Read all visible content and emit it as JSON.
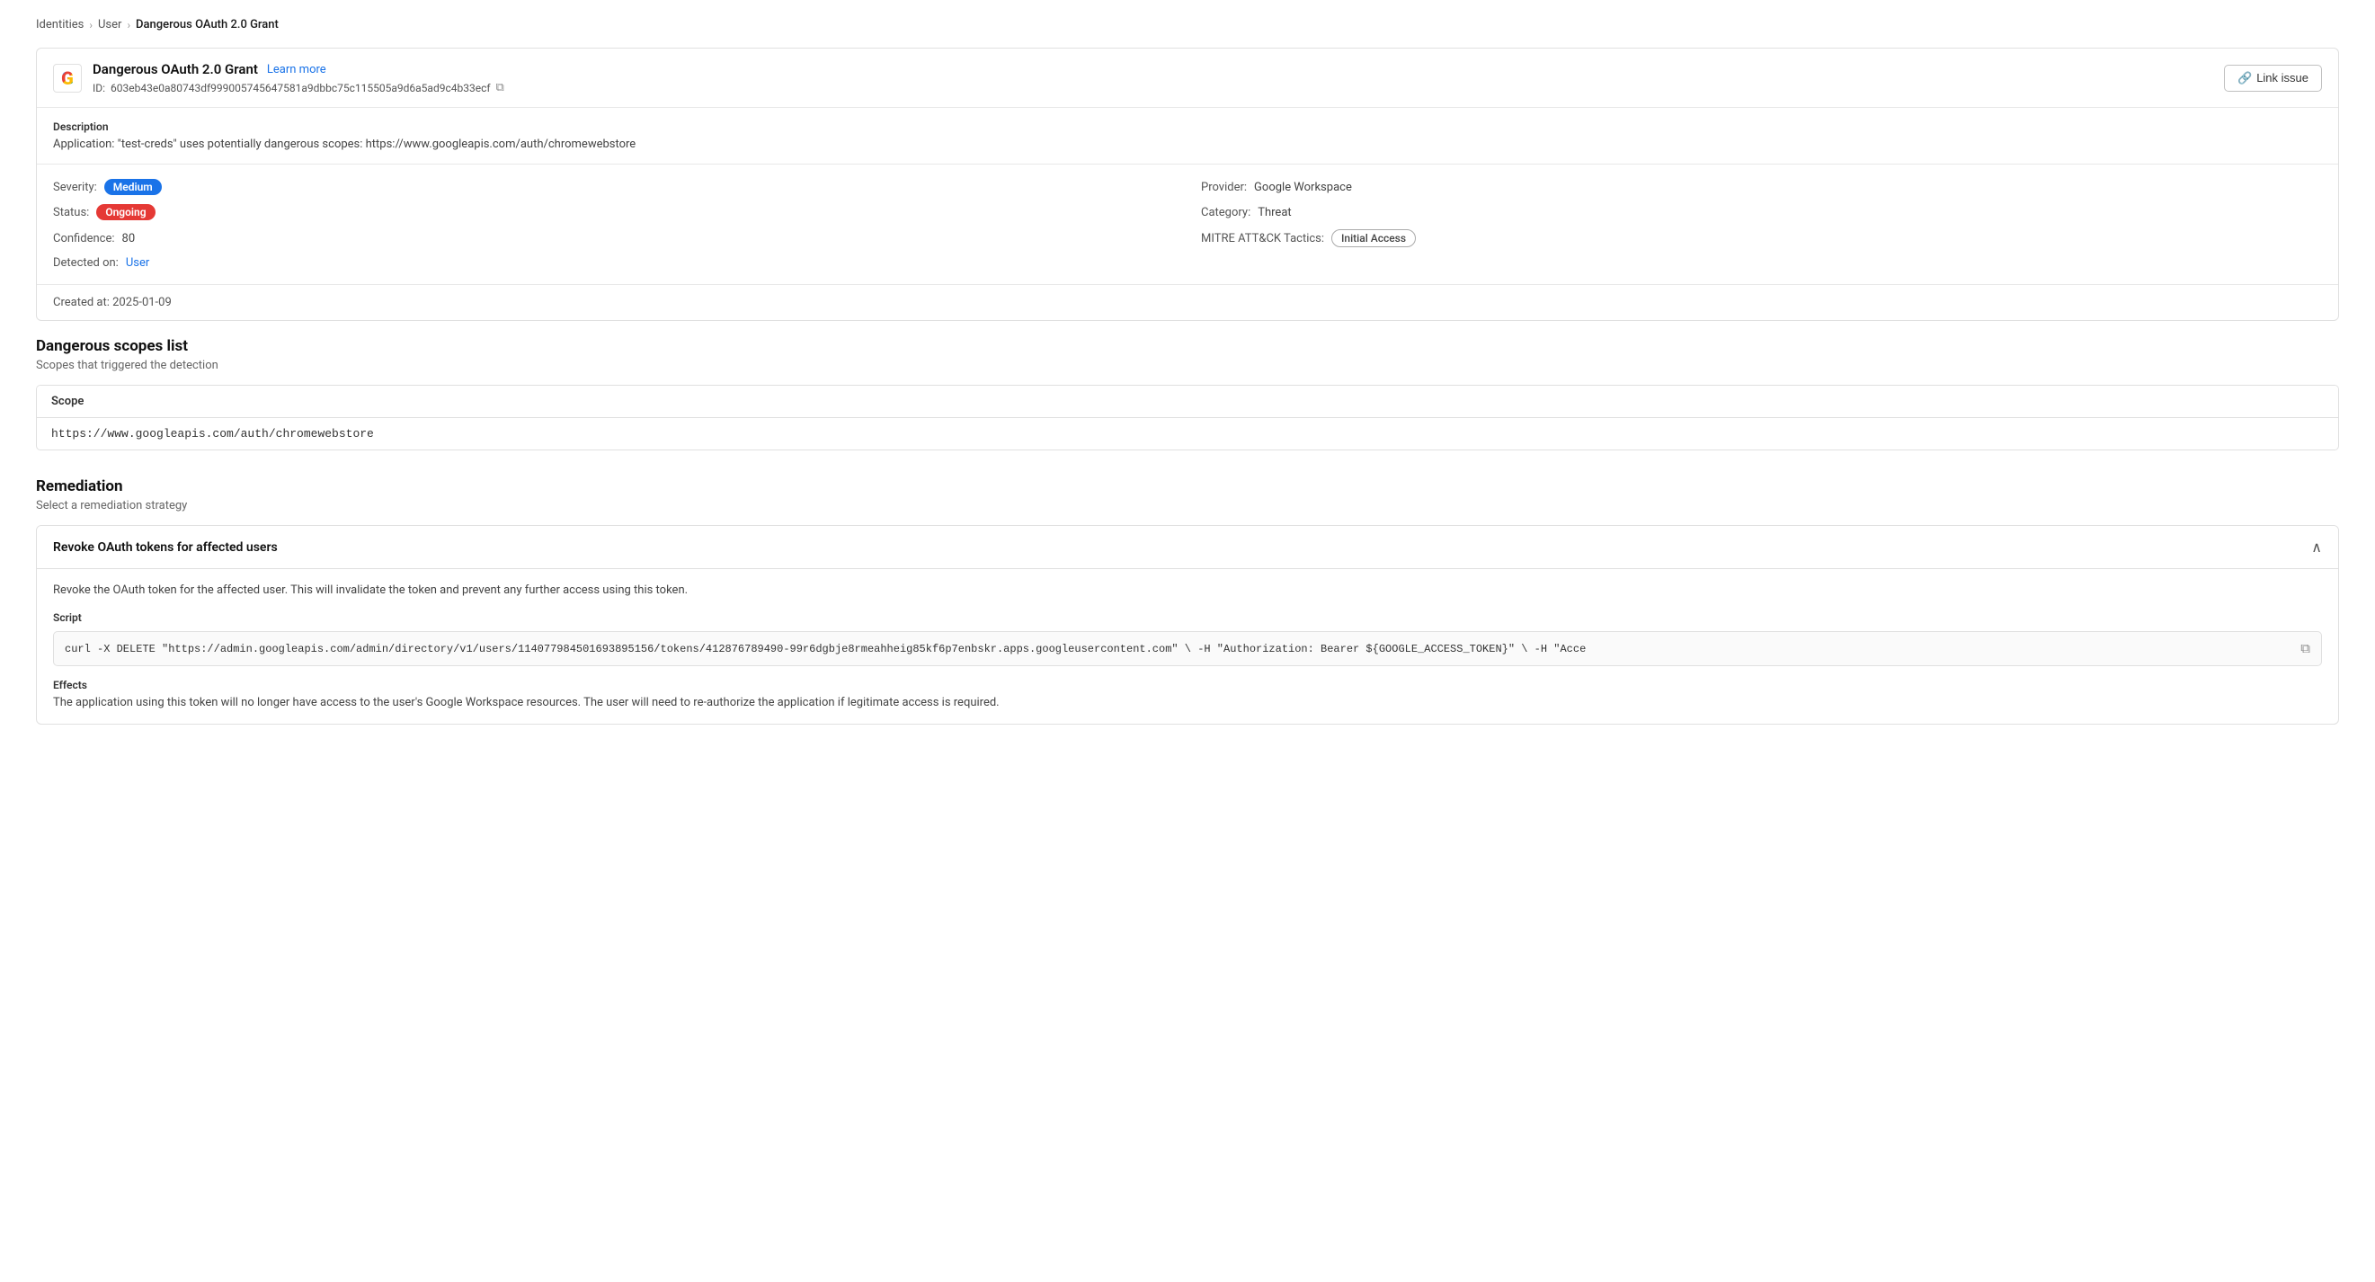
{
  "breadcrumb": {
    "items": [
      {
        "label": "Identities",
        "href": "#"
      },
      {
        "label": "User",
        "href": "#"
      },
      {
        "label": "Dangerous OAuth 2.0 Grant"
      }
    ]
  },
  "alert": {
    "title": "Dangerous OAuth 2.0 Grant",
    "learn_more_label": "Learn more",
    "learn_more_href": "#",
    "id_label": "ID:",
    "id_value": "603eb43e0a80743df99900574 5647581a9dbbc75c115505a9d6a5ad9c4b33ecf",
    "id_full": "603eb43e0a80743df999005745647581a9dbbc75c115505a9d6a5ad9c4b33ecf",
    "link_issue_label": "Link issue",
    "description_label": "Description",
    "description_text": "Application: \"test-creds\" uses potentially dangerous scopes: https://www.googleapis.com/auth/chromewebstore",
    "severity_label": "Severity:",
    "severity_value": "Medium",
    "provider_label": "Provider:",
    "provider_value": "Google Workspace",
    "status_label": "Status:",
    "status_value": "Ongoing",
    "category_label": "Category:",
    "category_value": "Threat",
    "confidence_label": "Confidence:",
    "confidence_value": "80",
    "mitre_label": "MITRE ATT&CK Tactics:",
    "mitre_value": "Initial Access",
    "detected_on_label": "Detected on:",
    "detected_on_value": "User",
    "created_at_label": "Created at:",
    "created_at_value": "2025-01-09"
  },
  "dangerous_scopes": {
    "section_title": "Dangerous scopes list",
    "section_subtitle": "Scopes that triggered the detection",
    "table_header": "Scope",
    "scope_value": "https://www.googleapis.com/auth/chromewebstore"
  },
  "remediation": {
    "section_title": "Remediation",
    "section_subtitle": "Select a remediation strategy",
    "card_title": "Revoke OAuth tokens for affected users",
    "description": "Revoke the OAuth token for the affected user. This will invalidate the token and prevent any further access using this token.",
    "script_label": "Script",
    "script_value": "curl -X DELETE  \"https://admin.googleapis.com/admin/directory/v1/users/114077984501693895156/tokens/412876789490-99r6dgbje8rmeahheig85kf6p7enbskr.apps.googleusercontent.com\" \\  -H \"Authorization: Bearer ${GOOGLE_ACCESS_TOKEN}\" \\  -H \"Acce",
    "effects_label": "Effects",
    "effects_text": "The application using this token will no longer have access to the user's Google Workspace resources. The user will need to re-authorize the application if legitimate access is required."
  },
  "icons": {
    "google_letter": "G",
    "link_icon": "🔗",
    "copy_icon": "⧉",
    "chevron_up": "∧",
    "copy_script_icon": "⧉"
  }
}
